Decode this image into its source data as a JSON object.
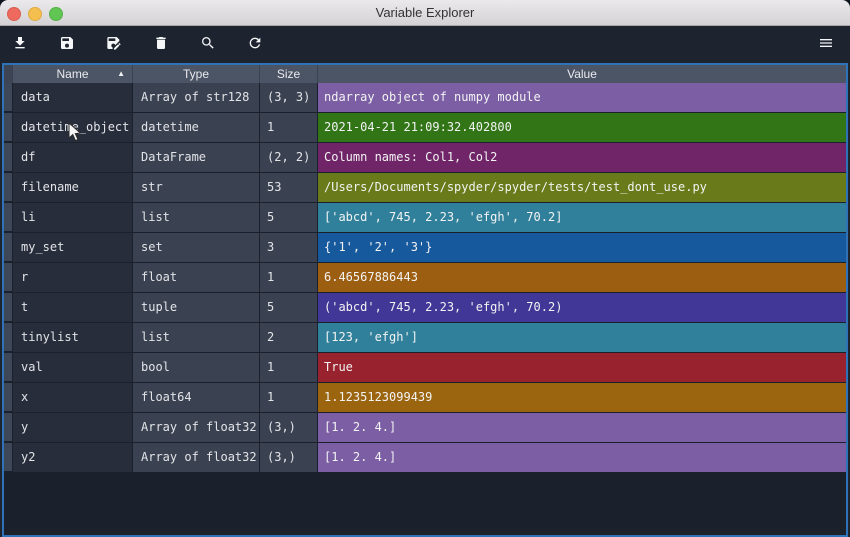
{
  "window": {
    "title": "Variable Explorer"
  },
  "titlebar": {
    "buttons": [
      "close",
      "minimize",
      "zoom"
    ]
  },
  "toolbar": {
    "icons": [
      "import-data",
      "save-data",
      "save-data-as",
      "remove-variable",
      "search",
      "refresh"
    ],
    "menu_icon": "hamburger-menu"
  },
  "theme": {
    "focus_border": "#2e73b8",
    "toolbar_bg": "#1d2430",
    "header_bg": "#4c5566",
    "table_bg": "#1a212c"
  },
  "table": {
    "columns": [
      "Name",
      "Type",
      "Size",
      "Value"
    ],
    "sort_column": "Name",
    "sort_indicator": "▲",
    "rows": [
      {
        "name": "data",
        "type": "Array of str128",
        "size": "(3, 3)",
        "value": "ndarray object of numpy module",
        "color": "#7b5ea4"
      },
      {
        "name": "datetime_object",
        "type": "datetime",
        "size": "1",
        "value": "2021-04-21 21:09:32.402800",
        "color": "#317517"
      },
      {
        "name": "df",
        "type": "DataFrame",
        "size": "(2, 2)",
        "value": "Column names: Col1, Col2",
        "color": "#702568"
      },
      {
        "name": "filename",
        "type": "str",
        "size": "53",
        "value": "/Users/Documents/spyder/spyder/tests/test_dont_use.py",
        "color": "#687a19"
      },
      {
        "name": "li",
        "type": "list",
        "size": "5",
        "value": "['abcd', 745, 2.23, 'efgh', 70.2]",
        "color": "#30809b"
      },
      {
        "name": "my_set",
        "type": "set",
        "size": "3",
        "value": "{'1', '2', '3'}",
        "color": "#17599d"
      },
      {
        "name": "r",
        "type": "float",
        "size": "1",
        "value": "6.46567886443",
        "color": "#9c5e11"
      },
      {
        "name": "t",
        "type": "tuple",
        "size": "5",
        "value": "('abcd', 745, 2.23, 'efgh', 70.2)",
        "color": "#413796"
      },
      {
        "name": "tinylist",
        "type": "list",
        "size": "2",
        "value": "[123, 'efgh']",
        "color": "#30809b"
      },
      {
        "name": "val",
        "type": "bool",
        "size": "1",
        "value": "True",
        "color": "#98222d"
      },
      {
        "name": "x",
        "type": "float64",
        "size": "1",
        "value": "1.1235123099439",
        "color": "#9b650f"
      },
      {
        "name": "y",
        "type": "Array of float32",
        "size": "(3,)",
        "value": "[1. 2. 4.]",
        "color": "#7b5ea4"
      },
      {
        "name": "y2",
        "type": "Array of float32",
        "size": "(3,)",
        "value": "[1. 2. 4.]",
        "color": "#7b5ea4"
      }
    ]
  }
}
